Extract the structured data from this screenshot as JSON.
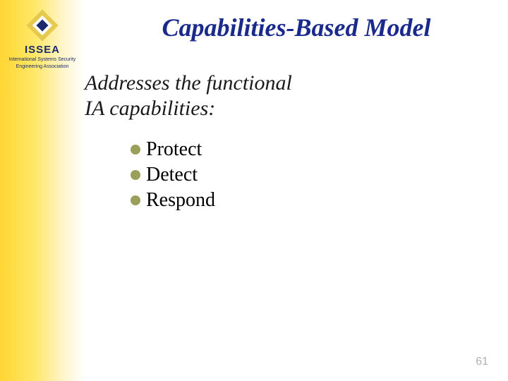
{
  "logo": {
    "acronym": "ISSEA",
    "subline1": "International Systems Security",
    "subline2": "Engineering Association"
  },
  "title": "Capabilities-Based Model",
  "subtitle_line1": "Addresses the functional",
  "subtitle_line2": "IA capabilities:",
  "bullets": {
    "0": "Protect",
    "1": "Detect",
    "2": "Respond"
  },
  "page_number": "61",
  "colors": {
    "title": "#1a2a8c",
    "bullet_dot": "#9aa05a",
    "sidebar_yellow": "#ffd633"
  }
}
